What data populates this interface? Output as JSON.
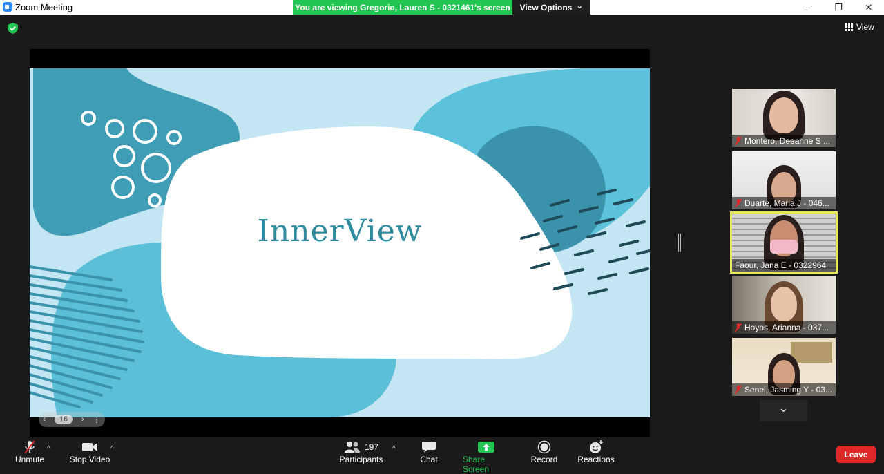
{
  "window": {
    "title": "Zoom Meeting",
    "minimize": "–",
    "restore": "❐",
    "close": "✕"
  },
  "banner": {
    "text": "You are viewing Gregorio, Lauren S - 0321461's screen",
    "view_options": "View Options",
    "chevron": "⌄"
  },
  "view_menu": {
    "label": "View",
    "icon": "grid-icon"
  },
  "slide": {
    "title": "InnerView",
    "page_number": "16",
    "prev": "‹",
    "next": "›",
    "more": "⋮"
  },
  "participants_panel": {
    "tiles": [
      {
        "name": "Montero, Deeanne S ...",
        "muted": true
      },
      {
        "name": "Duarte, Maria J - 046...",
        "muted": true
      },
      {
        "name": "Faour, Jana E - 0322964",
        "muted": false,
        "active_speaker": true
      },
      {
        "name": "Hoyos, Arianna - 037...",
        "muted": true
      },
      {
        "name": "Senel, Jasming Y - 03...",
        "muted": true
      }
    ],
    "scroll_down": "⌄"
  },
  "toolbar": {
    "unmute": "Unmute",
    "stop_video": "Stop Video",
    "participants": "Participants",
    "participants_count": "197",
    "chat": "Chat",
    "share_screen": "Share Screen",
    "record": "Record",
    "reactions": "Reactions",
    "leave": "Leave",
    "caret": "^"
  },
  "colors": {
    "banner_green": "#23c552",
    "leave_red": "#e02828",
    "active_outline": "#e6e85c",
    "slide_title": "#2e8a9e"
  }
}
